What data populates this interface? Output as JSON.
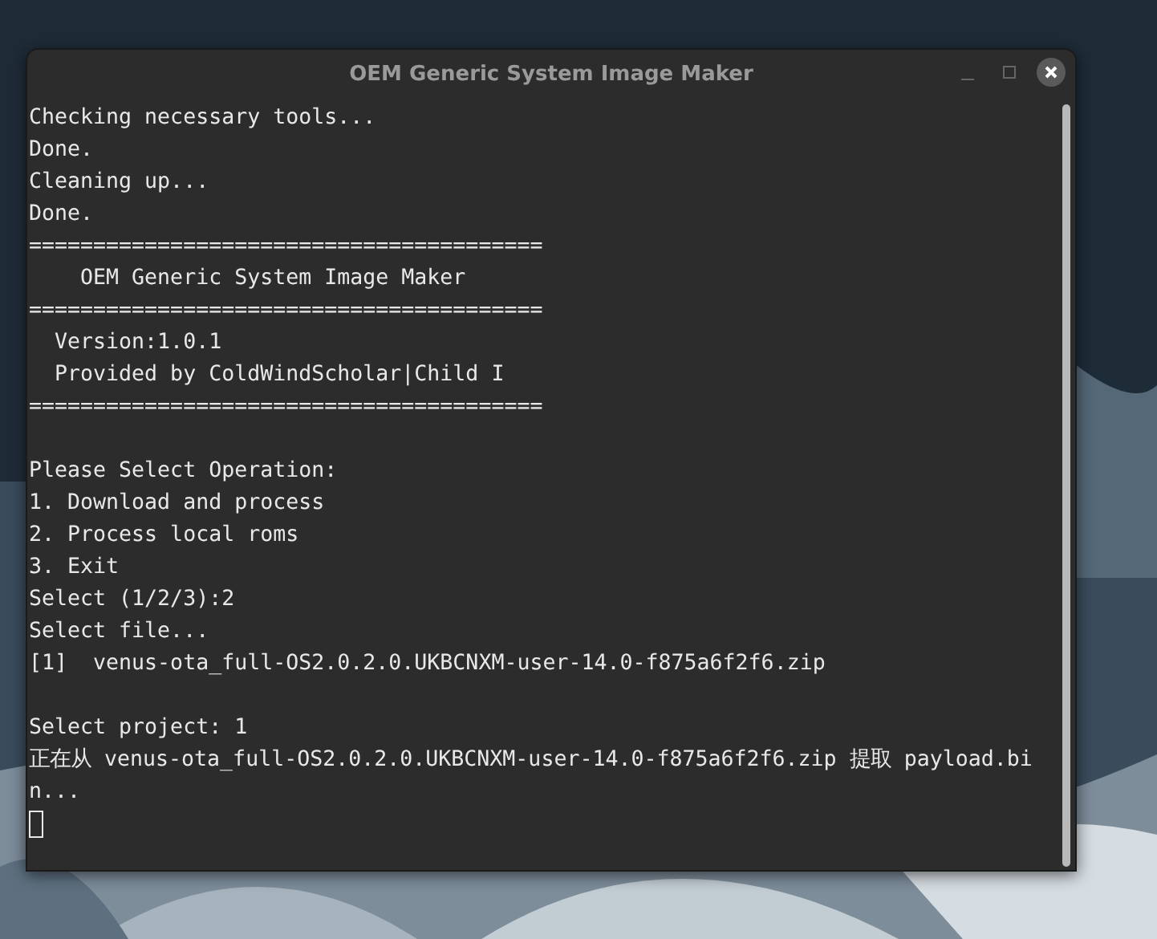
{
  "window": {
    "title": "OEM Generic System Image Maker"
  },
  "terminal": {
    "lines": [
      {
        "kind": "text",
        "text": "Checking necessary tools..."
      },
      {
        "kind": "text",
        "text": "Done."
      },
      {
        "kind": "text",
        "text": "Cleaning up..."
      },
      {
        "kind": "text",
        "text": "Done."
      },
      {
        "kind": "text",
        "text": "========================================"
      },
      {
        "kind": "text",
        "text": "    OEM Generic System Image Maker"
      },
      {
        "kind": "text",
        "text": "========================================"
      },
      {
        "kind": "text",
        "text": "  Version:1.0.1"
      },
      {
        "kind": "text",
        "text": "  Provided by ColdWindScholar|Child I"
      },
      {
        "kind": "text",
        "text": "========================================"
      },
      {
        "kind": "blank"
      },
      {
        "kind": "text",
        "text": "Please Select Operation:"
      },
      {
        "kind": "text",
        "text": "1. Download and process"
      },
      {
        "kind": "text",
        "text": "2. Process local roms"
      },
      {
        "kind": "text",
        "text": "3. Exit"
      },
      {
        "kind": "text",
        "text": "Select (1/2/3):2"
      },
      {
        "kind": "text",
        "text": "Select file..."
      },
      {
        "kind": "text",
        "text": "[1]  venus-ota_full-OS2.0.2.0.UKBCNXM-user-14.0-f875a6f2f6.zip"
      },
      {
        "kind": "blank"
      },
      {
        "kind": "text",
        "text": "Select project: 1"
      },
      {
        "kind": "text",
        "text": "正在从 venus-ota_full-OS2.0.2.0.UKBCNXM-user-14.0-f875a6f2f6.zip 提取 payload.bi"
      },
      {
        "kind": "text",
        "text": "n..."
      }
    ]
  }
}
